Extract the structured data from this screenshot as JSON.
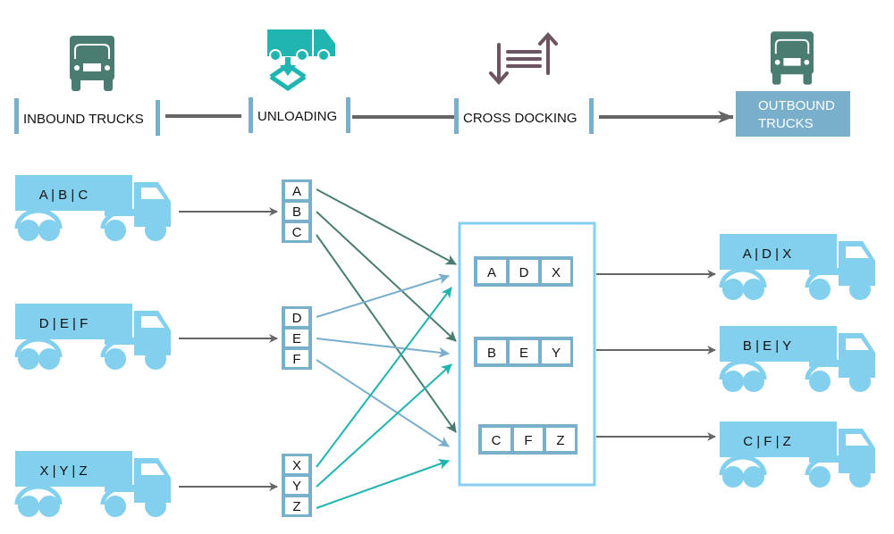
{
  "colors": {
    "truck": "#82cfee",
    "bar": "#7aafcc",
    "connector": "#666666",
    "dark_green": "#4a7c72",
    "teal": "#20b5b0",
    "light_blue": "#7aafcc",
    "cross_dock_icon": "#6b5560",
    "dock_border": "#87cff0"
  },
  "stages": [
    {
      "label": "INBOUND TRUCKS",
      "icon": "truck-front-icon"
    },
    {
      "label": "UNLOADING",
      "icon": "unloading-truck-icon"
    },
    {
      "label": "CROSS DOCKING",
      "icon": "cross-docking-arrows-icon"
    },
    {
      "label_line1": "OUTBOUND",
      "label_line2": "TRUCKS",
      "icon": "truck-front-icon"
    }
  ],
  "inbound_trucks": [
    {
      "label": "A | B | C",
      "items": [
        "A",
        "B",
        "C"
      ]
    },
    {
      "label": "D | E | F",
      "items": [
        "D",
        "E",
        "F"
      ]
    },
    {
      "label": "X | Y | Z",
      "items": [
        "X",
        "Y",
        "Z"
      ]
    }
  ],
  "cross_dock_groups": [
    {
      "items": [
        "A",
        "D",
        "X"
      ]
    },
    {
      "items": [
        "B",
        "E",
        "Y"
      ]
    },
    {
      "items": [
        "C",
        "F",
        "Z"
      ]
    }
  ],
  "outbound_trucks": [
    {
      "label": "A | D | X"
    },
    {
      "label": "B | E | Y"
    },
    {
      "label": "C | F | Z"
    }
  ],
  "flows": [
    {
      "from": "A",
      "to": "A | D | X"
    },
    {
      "from": "B",
      "to": "B | E | Y"
    },
    {
      "from": "C",
      "to": "C | F | Z"
    },
    {
      "from": "D",
      "to": "A | D | X"
    },
    {
      "from": "E",
      "to": "B | E | Y"
    },
    {
      "from": "F",
      "to": "C | F | Z"
    },
    {
      "from": "X",
      "to": "A | D | X"
    },
    {
      "from": "Y",
      "to": "B | E | Y"
    },
    {
      "from": "Z",
      "to": "C | F | Z"
    }
  ]
}
